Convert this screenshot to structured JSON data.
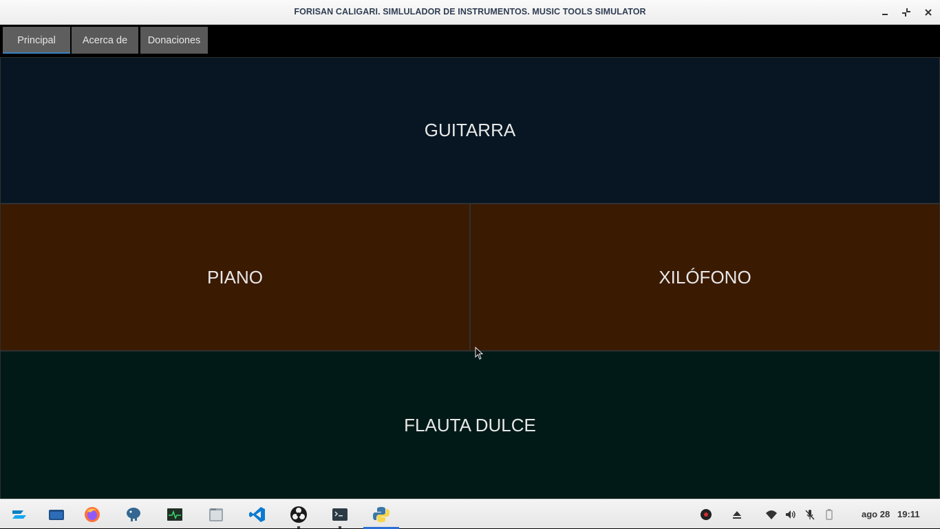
{
  "window": {
    "title": "FORISAN CALIGARI. SIMLULADOR DE INSTRUMENTOS. MUSIC TOOLS SIMULATOR",
    "controls": [
      "minimize-icon",
      "restore-icon",
      "close-icon"
    ]
  },
  "tabs": [
    {
      "label": "Principal",
      "active": true
    },
    {
      "label": "Acerca de",
      "active": false
    },
    {
      "label": "Donaciones",
      "active": false
    }
  ],
  "instruments": {
    "guitarra": {
      "label": "GUITARRA",
      "color": "#071622"
    },
    "piano": {
      "label": "PIANO",
      "color": "#3b1a02"
    },
    "xilofono": {
      "label": "XILÓFONO",
      "color": "#3b1a02"
    },
    "flauta": {
      "label": "FLAUTA DULCE",
      "color": "#021a17"
    }
  },
  "taskbar": {
    "apps": [
      "zorin-menu-icon",
      "files-window-icon",
      "firefox-icon",
      "postgres-elephant-icon",
      "system-monitor-icon",
      "file-manager-icon",
      "vscode-icon",
      "obs-icon",
      "terminal-icon",
      "python-icon"
    ],
    "tray": [
      "obs-tray-icon",
      "eject-icon",
      "wifi-icon",
      "volume-icon",
      "mic-muted-icon",
      "battery-icon"
    ],
    "date": "ago 28",
    "time": "19:11"
  }
}
